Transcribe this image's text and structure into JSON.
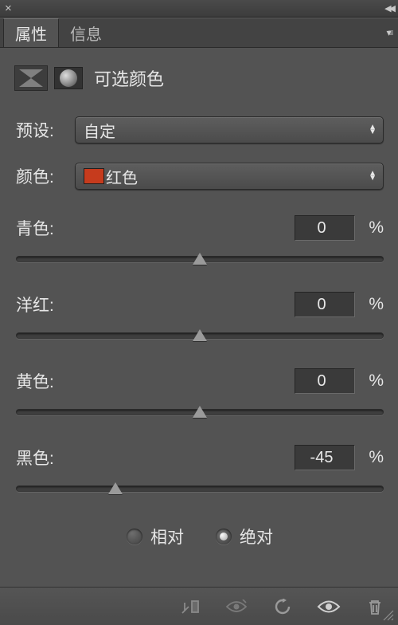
{
  "topbar": {
    "close": "×",
    "collapse": "◀◀"
  },
  "tabs": {
    "properties": "属性",
    "info": "信息"
  },
  "panel_title": "可选颜色",
  "preset": {
    "label": "预设:",
    "value": "自定"
  },
  "color_selector": {
    "label": "颜色:",
    "value": "红色",
    "swatch": "#c63b1d"
  },
  "sliders": [
    {
      "label": "青色:",
      "value": "0",
      "pos": 50
    },
    {
      "label": "洋红:",
      "value": "0",
      "pos": 50
    },
    {
      "label": "黄色:",
      "value": "0",
      "pos": 50
    },
    {
      "label": "黑色:",
      "value": "-45",
      "pos": 27
    }
  ],
  "percent": "%",
  "mode": {
    "relative": "相对",
    "absolute": "绝对",
    "selected": "absolute"
  }
}
